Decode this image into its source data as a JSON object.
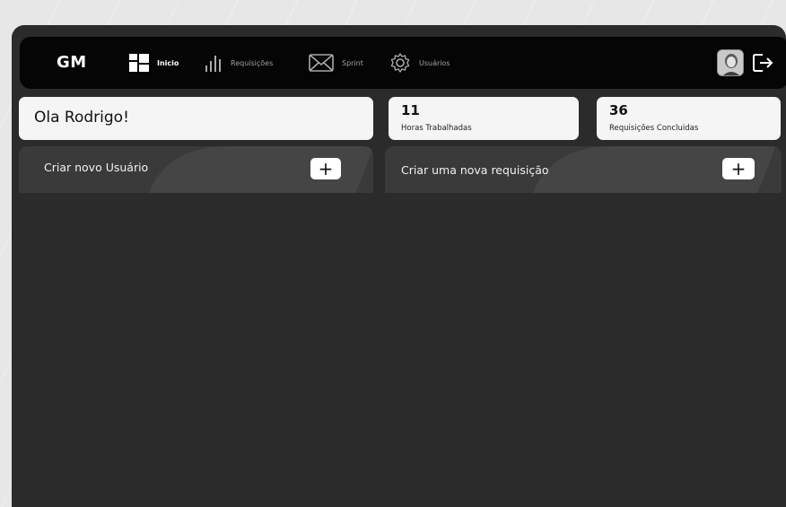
{
  "nav": {
    "logo": "GM",
    "items": [
      {
        "label": "Inicio",
        "icon": "dashboard-icon",
        "active": true
      },
      {
        "label": "Requisições",
        "icon": "bar-chart-icon",
        "active": false
      },
      {
        "label": "Sprint",
        "icon": "mail-icon",
        "active": false
      },
      {
        "label": "Usuários",
        "icon": "gear-icon",
        "active": false
      }
    ],
    "avatar_icon": "avatar-icon",
    "logout_icon": "logout-icon"
  },
  "greeting": "Ola Rodrigo!",
  "stats": [
    {
      "value": "11",
      "label": "Horas Trabalhadas"
    },
    {
      "value": "36",
      "label": "Requisições Concluidas"
    }
  ],
  "actions": [
    {
      "label": "Criar novo Usuário",
      "button": "+"
    },
    {
      "label": "Criar uma nova requisição",
      "button": "+"
    }
  ],
  "colors": {
    "background": "#e7e7e7",
    "panel": "#2b2b2b",
    "navbar": "#050505",
    "card": "#f5f5f5",
    "action_bar": "#3a3a3a"
  }
}
